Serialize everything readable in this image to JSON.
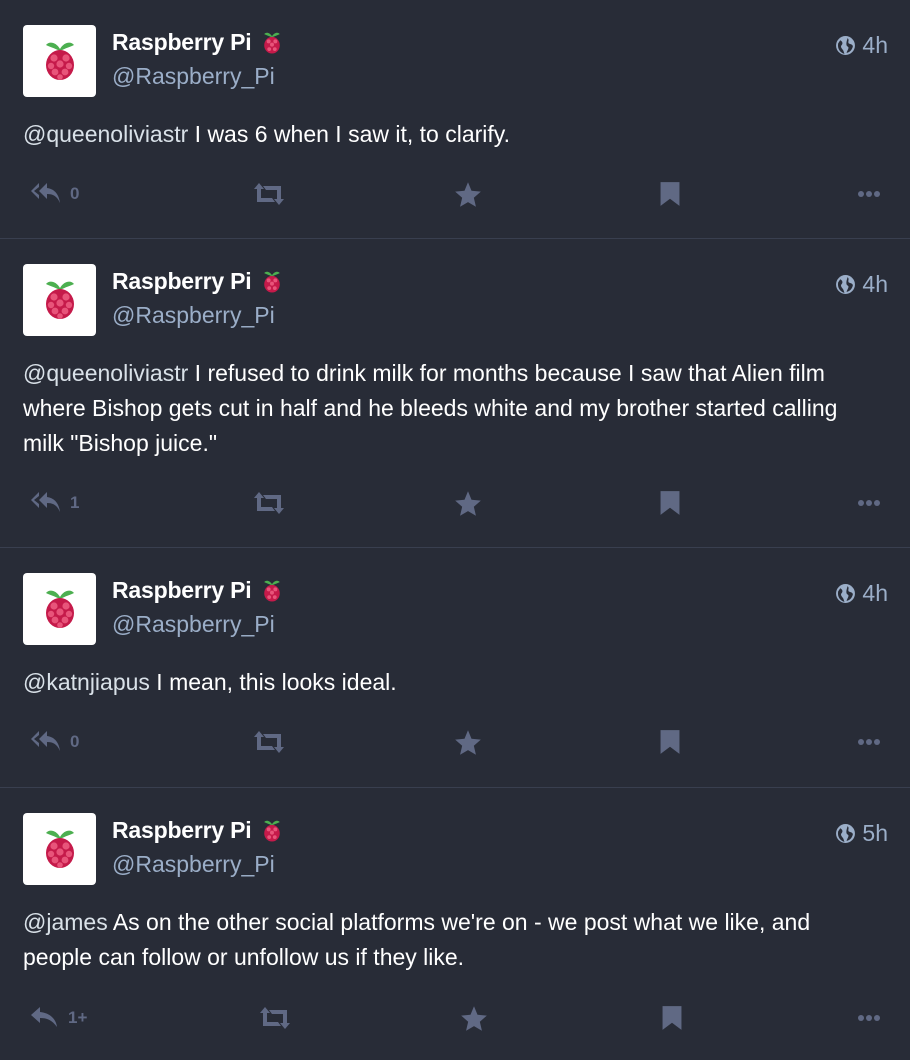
{
  "colors": {
    "background": "#282c37",
    "divider": "#393f4f",
    "secondary_text": "#9baec8",
    "icon": "#606984",
    "mention": "#d9e1e8"
  },
  "statuses": [
    {
      "display_name": "Raspberry Pi",
      "handle": "@Raspberry_Pi",
      "time": "4h",
      "mention": "@queenoliviastr",
      "text": " I was 6 when I saw it, to clarify.",
      "reply_count": "0",
      "reply_icon": "reply-all-icon"
    },
    {
      "display_name": "Raspberry Pi",
      "handle": "@Raspberry_Pi",
      "time": "4h",
      "mention": "@queenoliviastr",
      "text": " I refused to drink milk for months because I saw that Alien film where Bishop gets cut in half and he bleeds white and my brother started calling milk \"Bishop juice.\"",
      "reply_count": "1",
      "reply_icon": "reply-all-icon"
    },
    {
      "display_name": "Raspberry Pi",
      "handle": "@Raspberry_Pi",
      "time": "4h",
      "mention": "@katnjiapus",
      "text": " I mean, this looks ideal.",
      "reply_count": "0",
      "reply_icon": "reply-all-icon"
    },
    {
      "display_name": "Raspberry Pi",
      "handle": "@Raspberry_Pi",
      "time": "5h",
      "mention": "@james",
      "text": " As on the other social platforms we're on - we post what we like, and people can follow or unfollow us if they like.",
      "reply_count": "1+",
      "reply_icon": "reply-icon"
    }
  ]
}
